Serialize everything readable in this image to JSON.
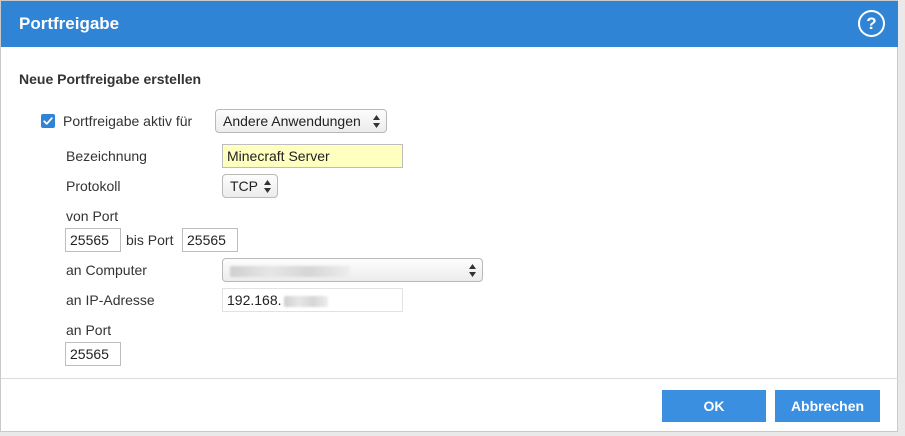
{
  "dialog": {
    "title": "Portfreigabe",
    "help_symbol": "?"
  },
  "section_title": "Neue Portfreigabe erstellen",
  "form": {
    "enabled_label": "Portfreigabe aktiv für",
    "enabled_checked": true,
    "application_select_value": "Andere Anwendungen",
    "name_label": "Bezeichnung",
    "name_value": "Minecraft Server",
    "protocol_label": "Protokoll",
    "protocol_value": "TCP",
    "from_port_label": "von Port",
    "from_port_value": "25565",
    "to_port_label": "bis Port",
    "to_port_value": "25565",
    "computer_label": "an Computer",
    "ip_label": "an IP-Adresse",
    "ip_value_prefix": "192.168.",
    "target_port_label": "an Port",
    "target_port_value": "25565"
  },
  "buttons": {
    "ok": "OK",
    "cancel": "Abbrechen"
  },
  "colors": {
    "accent": "#2f84d6",
    "highlight_input": "#ffffc0"
  }
}
